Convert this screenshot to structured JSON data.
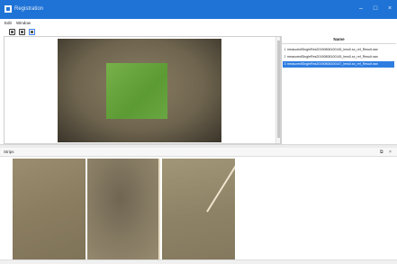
{
  "window": {
    "title": "Registration",
    "icon": "app-icon",
    "controls": {
      "minimize": "–",
      "maximize": "□",
      "close": "×"
    }
  },
  "menu": {
    "items": [
      "Edit",
      "Window"
    ]
  },
  "toolbar": {
    "buttons": [
      {
        "icon": "tool-icon",
        "color": "#3a3a3a"
      },
      {
        "icon": "tool-icon",
        "color": "#3a3a3a"
      },
      {
        "icon": "tool-icon",
        "color": "#2f7de1"
      }
    ]
  },
  "file_list": {
    "header": "Name",
    "rows": [
      {
        "index": "1",
        "name": "measuredSingleRes20190808100145_lens0.sx_ref_Result.raw",
        "selected": false
      },
      {
        "index": "2",
        "name": "measuredSingleRes20190808100145_lens0.sx_ref_Result.raw",
        "selected": false
      },
      {
        "index": "3",
        "name": "measuredSingleRes20190808100147_lens0.sx_ref_Result.raw",
        "selected": true
      }
    ]
  },
  "strip": {
    "title": "Strips",
    "controls": {
      "float": "⧉",
      "close": "×"
    }
  },
  "colors": {
    "titlebar": "#1f73d6",
    "selection": "#2f7de1",
    "patch": "#6aa742"
  }
}
